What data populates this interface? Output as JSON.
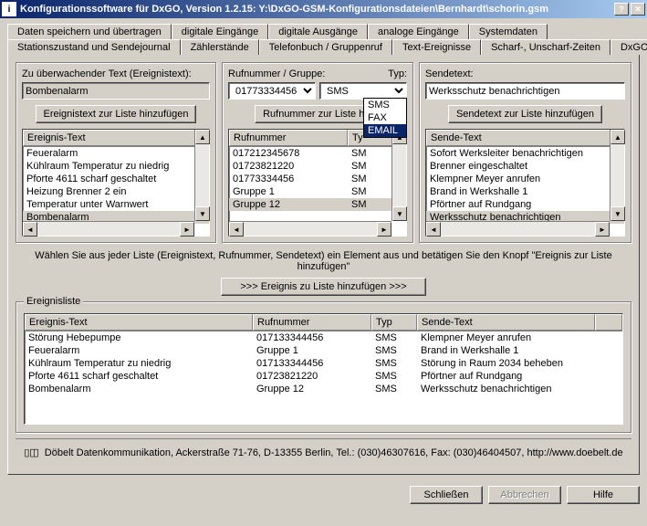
{
  "titlebar": {
    "app_icon": "i",
    "title": "Konfigurationssoftware für DxGO, Version 1.2.15:   Y:\\DxGO-GSM-Konfigurationsdateien\\Bernhardt\\schorin.gsm"
  },
  "tabs_row1": [
    "Daten speichern und übertragen",
    "digitale Eingänge",
    "digitale Ausgänge",
    "analoge Eingänge",
    "Systemdaten"
  ],
  "tabs_row2": [
    "Stationszustand und Sendejournal",
    "Zählerstände",
    "Telefonbuch / Gruppenruf",
    "Text-Ereignisse",
    "Scharf-, Unscharf-Zeiten",
    "DxGO"
  ],
  "active_tab": "Text-Ereignisse",
  "left": {
    "label": "Zu überwachender Text (Ereignistext):",
    "value": "Bombenalarm",
    "add_btn": "Ereignistext zur Liste hinzufügen",
    "list_header": "Ereignis-Text",
    "items": [
      {
        "text": "Feueralarm",
        "selected": false
      },
      {
        "text": "Kühlraum Temperatur zu niedrig",
        "selected": false
      },
      {
        "text": "Pforte 4611 scharf geschaltet",
        "selected": false
      },
      {
        "text": "Heizung Brenner 2 ein",
        "selected": false
      },
      {
        "text": "Temperatur unter Warnwert",
        "selected": false
      },
      {
        "text": "Bombenalarm",
        "selected": true
      }
    ]
  },
  "mid": {
    "label_ruf": "Rufnummer / Gruppe:",
    "label_typ": "Typ:",
    "ruf_value": "01773334456",
    "typ_value": "SMS",
    "typ_options": [
      "SMS",
      "FAX",
      "EMAIL"
    ],
    "typ_selected_option": "EMAIL",
    "add_btn": "Rufnummer zur Liste hin",
    "header_ruf": "Rufnummer",
    "header_typ": "Ty",
    "items": [
      {
        "ruf": "017212345678",
        "typ": "SM",
        "selected": false
      },
      {
        "ruf": "01723821220",
        "typ": "SM",
        "selected": false
      },
      {
        "ruf": "01773334456",
        "typ": "SM",
        "selected": false
      },
      {
        "ruf": "Gruppe 1",
        "typ": "SM",
        "selected": false
      },
      {
        "ruf": "Gruppe 12",
        "typ": "SM",
        "selected": true
      }
    ]
  },
  "right": {
    "label": "Sendetext:",
    "value": "Werksschutz benachrichtigen",
    "add_btn": "Sendetext zur Liste hinzufügen",
    "list_header": "Sende-Text",
    "items": [
      {
        "text": "Sofort Werksleiter benachrichtigen",
        "selected": false
      },
      {
        "text": "Brenner eingeschaltet",
        "selected": false
      },
      {
        "text": "Klempner Meyer anrufen",
        "selected": false
      },
      {
        "text": "Brand in Werkshalle 1",
        "selected": false
      },
      {
        "text": "Pförtner auf Rundgang",
        "selected": false
      },
      {
        "text": "Werksschutz benachrichtigen",
        "selected": true
      }
    ]
  },
  "instruction": "Wählen Sie aus jeder Liste (Ereignistext, Rufnummer, Sendetext) ein Element aus und betätigen Sie den Knopf \"Ereignis zur Liste hinzufügen\"",
  "add_event_btn": ">>> Ereignis zu Liste hinzufügen >>>",
  "ereignisliste": {
    "legend": "Ereignisliste",
    "headers": [
      "Ereignis-Text",
      "Rufnummer",
      "Typ",
      "Sende-Text"
    ],
    "rows": [
      {
        "e": "Störung Hebepumpe",
        "r": "017133344456",
        "t": "SMS",
        "s": "Klempner Meyer anrufen"
      },
      {
        "e": "Feueralarm",
        "r": "Gruppe 1",
        "t": "SMS",
        "s": "Brand in Werkshalle 1"
      },
      {
        "e": "Kühlraum Temperatur zu niedrig",
        "r": "017133344456",
        "t": "SMS",
        "s": "Störung in Raum 2034 beheben"
      },
      {
        "e": "Pforte 4611 scharf geschaltet",
        "r": "01723821220",
        "t": "SMS",
        "s": "Pförtner auf Rundgang"
      },
      {
        "e": "Bombenalarm",
        "r": "Gruppe 12",
        "t": "SMS",
        "s": "Werksschutz benachrichtigen"
      }
    ]
  },
  "footer": "Döbelt Datenkommunikation, Ackerstraße 71-76, D-13355 Berlin, Tel.: (030)46307616, Fax: (030)46404507, http://www.doebelt.de",
  "buttons": {
    "close": "Schließen",
    "cancel": "Abbrechen",
    "help": "Hilfe"
  }
}
